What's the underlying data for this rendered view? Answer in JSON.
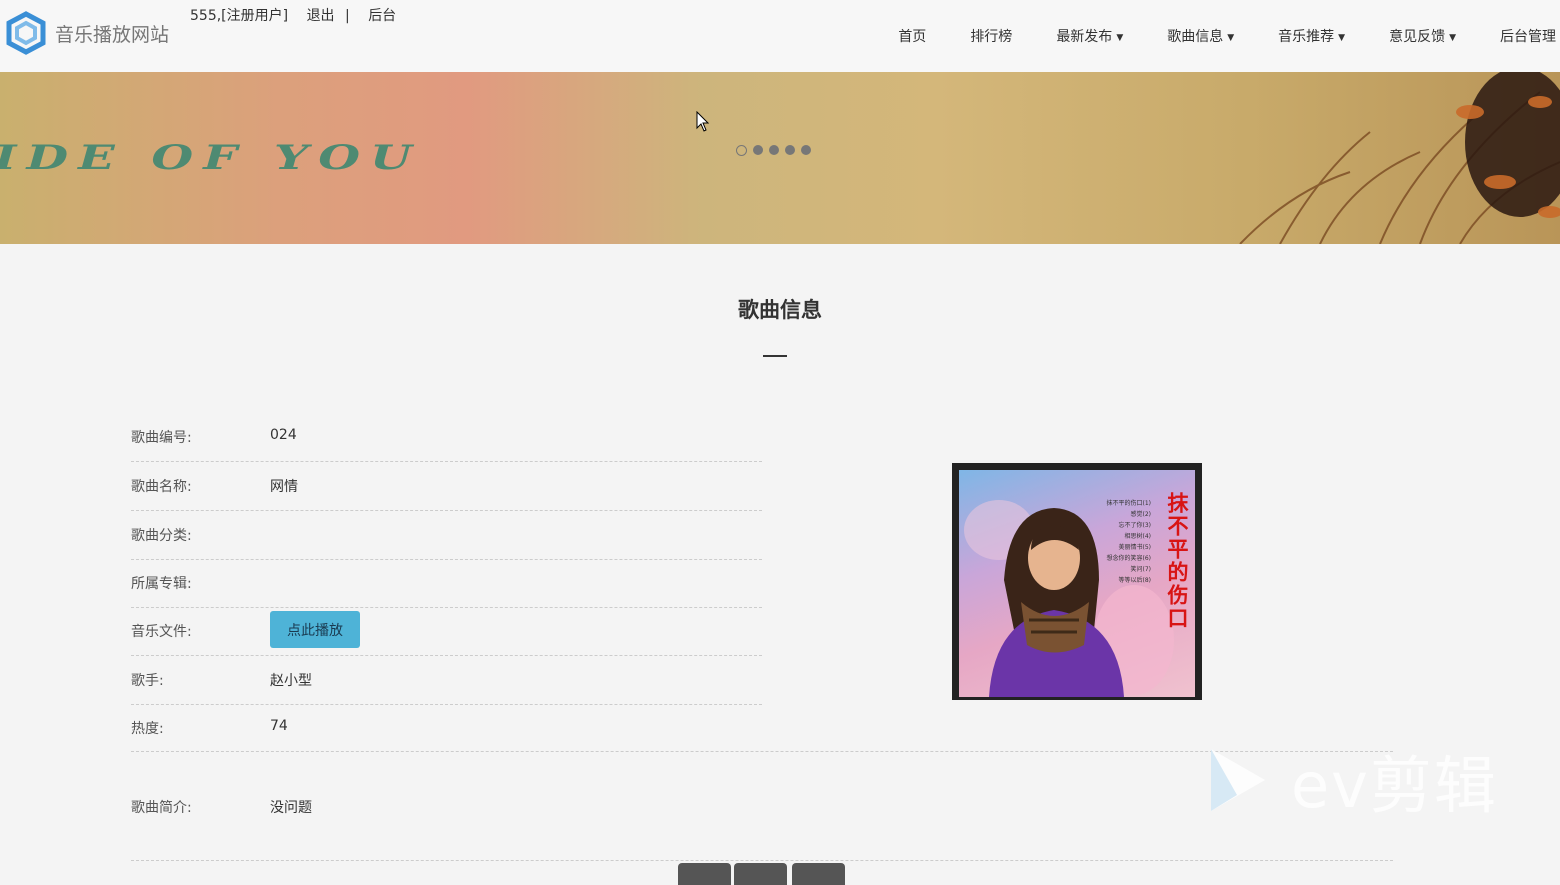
{
  "header": {
    "site_title": "音乐播放网站",
    "user": "555,[注册用户]",
    "logout": "退出",
    "separator": "|",
    "backend": "后台",
    "logo_icon": "hexagon-logo-icon"
  },
  "nav": [
    {
      "label": "首页",
      "dropdown": false
    },
    {
      "label": "排行榜",
      "dropdown": false
    },
    {
      "label": "最新发布",
      "dropdown": true
    },
    {
      "label": "歌曲信息",
      "dropdown": true
    },
    {
      "label": "音乐推荐",
      "dropdown": true
    },
    {
      "label": "意见反馈",
      "dropdown": true
    },
    {
      "label": "后台管理",
      "dropdown": false
    }
  ],
  "banner": {
    "text": "IDE OF YOU",
    "slides": 5,
    "active_slide": 0
  },
  "main": {
    "heading": "歌曲信息",
    "rows": [
      {
        "label": "歌曲编号:",
        "value": "024"
      },
      {
        "label": "歌曲名称:",
        "value": "网情"
      },
      {
        "label": "歌曲分类:",
        "value": ""
      },
      {
        "label": "所属专辑:",
        "value": ""
      },
      {
        "label": "音乐文件:",
        "button": "点此播放"
      },
      {
        "label": "歌手:",
        "value": "赵小型"
      },
      {
        "label": "热度:",
        "value": "74"
      }
    ],
    "intro_label": "歌曲简介:",
    "intro_value": "没问题"
  },
  "cover": {
    "title": "抹不平的伤口",
    "tracks": [
      "抹不平的伤口(1)",
      "感觉(2)",
      "忘不了你(3)",
      "相思树(4)",
      "美丽情书(5)",
      "想念你的笑容(6)",
      "笑问(7)",
      "等等以后(8)"
    ]
  },
  "watermark": {
    "text": "ev剪辑"
  },
  "colors": {
    "accent_button": "#4eb3d7",
    "cover_title": "#d81414",
    "banner_text": "#4e8a72"
  }
}
